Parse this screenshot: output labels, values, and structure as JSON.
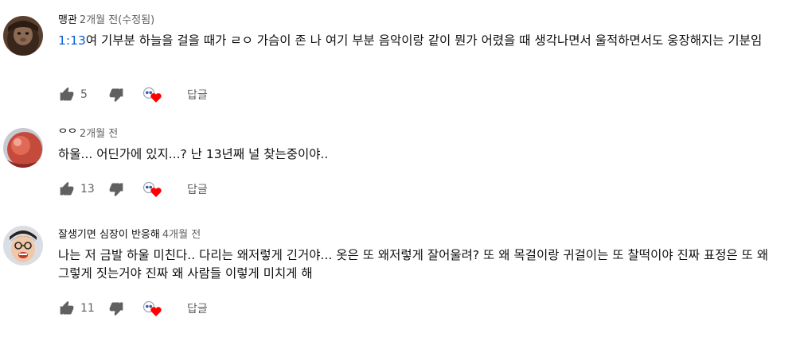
{
  "comments": [
    {
      "author": "맹관",
      "time": "2개월 전(수정됨)",
      "timestamp": "1:13",
      "text": "여 기부분 하늘을 걸을 때가 ㄹㅇ 가슴이 존  나 여기 부분 음악이랑 같이 뭔가 어렸을 때 생각나면서 울적하면서도 웅장해지는 기분임",
      "likes": "5",
      "reply_label": "답글"
    },
    {
      "author": "ᄋᄋ",
      "time": "2개월 전",
      "timestamp": "",
      "text": "하울... 어딘가에 있지...? 난 13년째 널 찾는중이야..",
      "likes": "13",
      "reply_label": "답글"
    },
    {
      "author": "잘생기면 심장이 반응해",
      "time": "4개월 전",
      "timestamp": "",
      "text": "나는 저 금발 하울 미친다.. 다리는 왜저렇게 긴거야... 옷은 또 왜저렇게 잘어울려? 또 왜 목걸이랑 귀걸이는 또 찰떡이야 진짜 표정은 또 왜 그렇게 짓는거야 진짜 왜 사람들 이렇게 미치게 해",
      "likes": "11",
      "reply_label": "답글"
    }
  ],
  "colors": {
    "link": "#065fd4",
    "secondary_text": "#606060",
    "heart": "#ff0000"
  },
  "icons": {
    "like": "thumbs-up-icon",
    "dislike": "thumbs-down-icon",
    "creator_heart": "creator-heart-icon"
  }
}
